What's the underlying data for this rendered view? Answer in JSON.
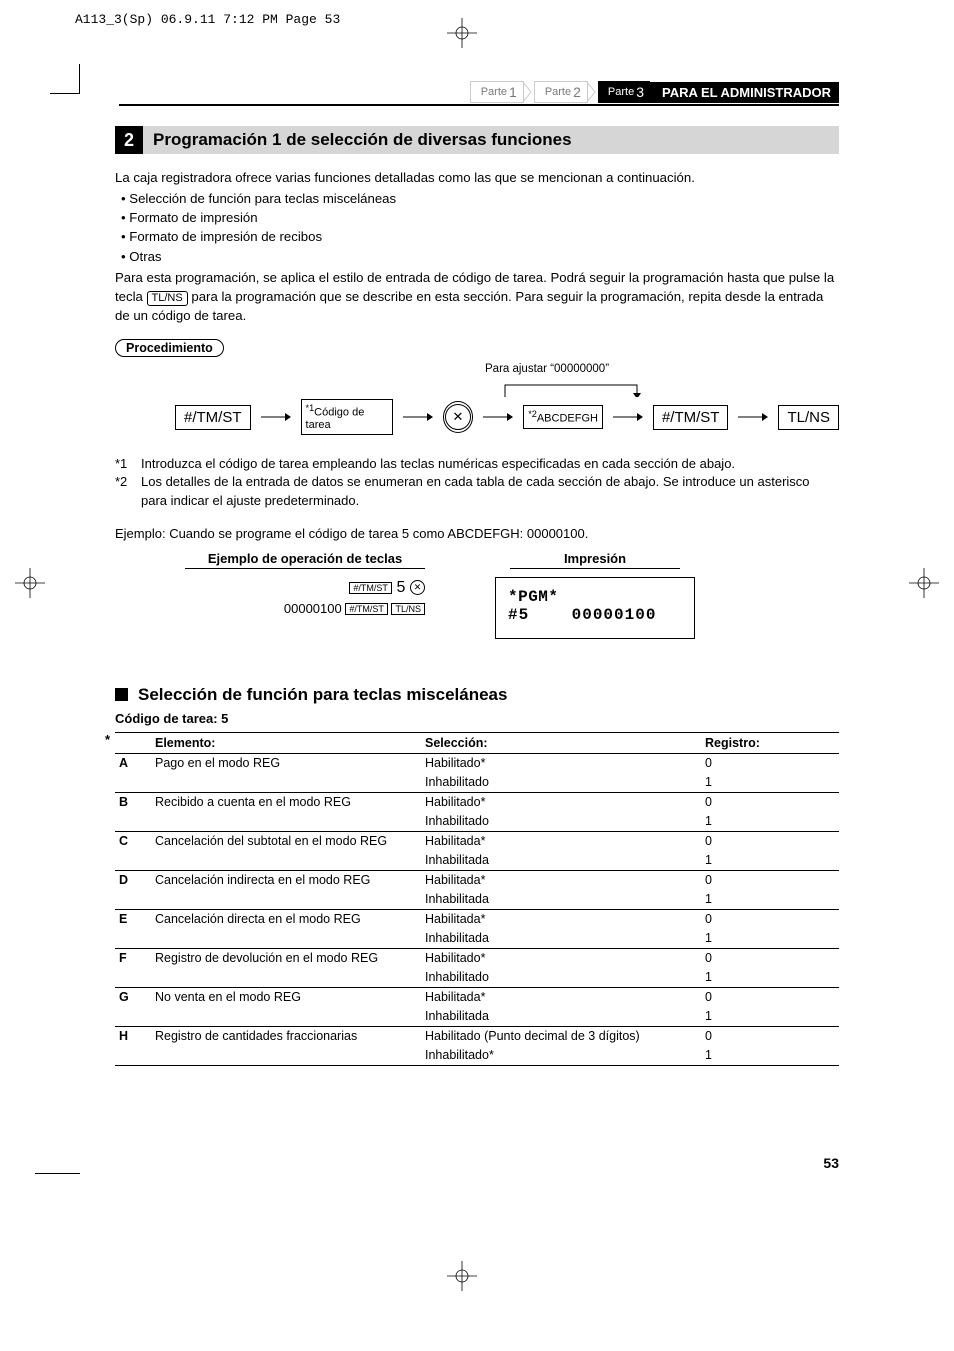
{
  "print_header": "A113_3(Sp)  06.9.11 7:12 PM  Page 53",
  "breadcrumb": {
    "p1_label": "Parte",
    "p1_num": "1",
    "p2_label": "Parte",
    "p2_num": "2",
    "p3_label": "Parte",
    "p3_num": "3",
    "title": "PARA EL ADMINISTRADOR"
  },
  "section": {
    "num": "2",
    "title": "Programación 1 de selección de diversas funciones"
  },
  "intro": {
    "p1": "La caja registradora ofrece varias funciones detalladas como las que se mencionan a continuación.",
    "b1": "• Selección de función para teclas misceláneas",
    "b2": "• Formato de impresión",
    "b3": "• Formato de impresión de recibos",
    "b4": "• Otras",
    "p2a": "Para esta programación, se aplica el estilo de entrada de código de tarea. Podrá seguir la programación hasta que pulse la tecla ",
    "p2key": "TL/NS",
    "p2b": " para la programación que se describe en esta sección. Para seguir la programación, repita desde la entrada de un código de tarea."
  },
  "proc_label": "Procedimiento",
  "flow": {
    "k1": "#/TM/ST",
    "k2_sup": "*1",
    "k2": "Código de tarea",
    "circle": "✕",
    "k3_sup": "*2",
    "k3": "ABCDEFGH",
    "k4": "#/TM/ST",
    "k5": "TL/NS",
    "caption": "Para ajustar “00000000”"
  },
  "notes": {
    "n1l": "*1",
    "n1t": "Introduzca el código de tarea empleando las teclas numéricas especificadas en cada sección de abajo.",
    "n2l": "*2",
    "n2t": "Los detalles de la entrada de datos se enumeran en cada tabla de cada sección de abajo. Se introduce un asterisco para indicar el ajuste predeterminado."
  },
  "example_line": "Ejemplo:  Cuando se programe el código de tarea 5 como ABCDEFGH: 00000100.",
  "cols": {
    "left_h": "Ejemplo de operación de teclas",
    "right_h": "Impresión",
    "seq1_k1": "#/TM/ST",
    "seq1_big": "5",
    "seq2_pre": "00000100",
    "seq2_k1": "#/TM/ST",
    "seq2_k2": "TL/NS",
    "print_l1": "*PGM*",
    "print_l2a": "#5",
    "print_l2b": "00000100"
  },
  "sub": {
    "title": "Selección de función para teclas misceláneas",
    "job": "Código de tarea: 5"
  },
  "table": {
    "h_elem": "Elemento:",
    "h_sel": "Selección:",
    "h_reg": "Registro:",
    "rows": [
      {
        "l": "A",
        "e": "Pago en el modo REG",
        "s": "Habilitado*",
        "r": "0"
      },
      {
        "l": "",
        "e": "",
        "s": "Inhabilitado",
        "r": "1"
      },
      {
        "l": "B",
        "e": "Recibido a cuenta en el modo REG",
        "s": "Habilitado*",
        "r": "0"
      },
      {
        "l": "",
        "e": "",
        "s": "Inhabilitado",
        "r": "1"
      },
      {
        "l": "C",
        "e": "Cancelación del subtotal en el modo REG",
        "s": "Habilitada*",
        "r": "0"
      },
      {
        "l": "",
        "e": "",
        "s": "Inhabilitada",
        "r": "1"
      },
      {
        "l": "D",
        "e": "Cancelación indirecta en el modo REG",
        "s": "Habilitada*",
        "r": "0"
      },
      {
        "l": "",
        "e": "",
        "s": "Inhabilitada",
        "r": "1"
      },
      {
        "l": "E",
        "e": "Cancelación directa en el modo REG",
        "s": "Habilitada*",
        "r": "0"
      },
      {
        "l": "",
        "e": "",
        "s": "Inhabilitada",
        "r": "1"
      },
      {
        "l": "F",
        "e": "Registro de devolución en el modo REG",
        "s": "Habilitado*",
        "r": "0"
      },
      {
        "l": "",
        "e": "",
        "s": "Inhabilitado",
        "r": "1"
      },
      {
        "l": "G",
        "e": "No venta en el modo REG",
        "s": "Habilitada*",
        "r": "0"
      },
      {
        "l": "",
        "e": "",
        "s": "Inhabilitada",
        "r": "1"
      },
      {
        "l": "H",
        "e": "Registro de cantidades fraccionarias",
        "s": "Habilitado (Punto decimal de 3 dígitos)",
        "r": "0"
      },
      {
        "l": "",
        "e": "",
        "s": "Inhabilitado*",
        "r": "1"
      }
    ]
  },
  "page_num": "53"
}
